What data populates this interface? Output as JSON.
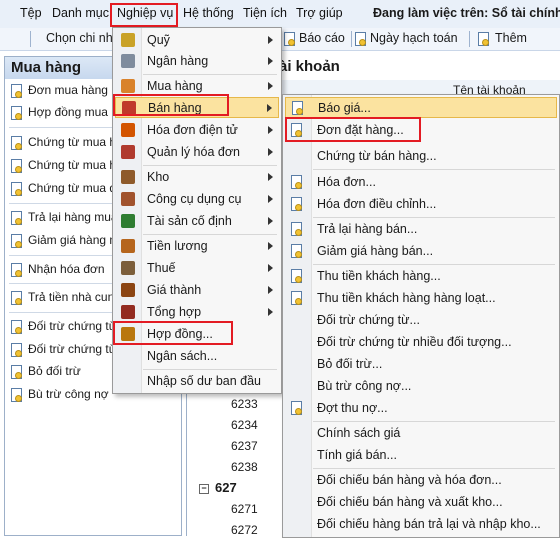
{
  "menubar": {
    "items": [
      "Tệp",
      "Danh mục",
      "Nghiệp vụ",
      "Hệ thống",
      "Tiện ích",
      "Trợ giúp"
    ],
    "status": "Đang làm việc trên: Sổ tài chính -"
  },
  "toolbar": {
    "items": [
      "Chọn chi nhá",
      "Báo cáo",
      "Ngày hạch toán",
      "Thêm"
    ]
  },
  "left_panel": {
    "title": "Mua hàng",
    "items": [
      "Đơn mua hàng",
      "Hợp đồng mua h",
      "Chứng từ mua hà",
      "Chứng từ mua h",
      "Chứng từ mua dị",
      "Trả lại hàng mua",
      "Giảm giá hàng m",
      "Nhận hóa đơn",
      "Trả tiền nhà cun",
      "Đối trừ chứng từ",
      "Đối trừ chứng từ",
      "Bỏ đối trừ",
      "Bù trừ công nợ"
    ]
  },
  "right_panel": {
    "title": "ài khoản",
    "col_name": "Tên tài khoản",
    "rows_before": [
      "6233",
      "6234",
      "6237",
      "6238"
    ],
    "group": "627",
    "rows_after": [
      "6271",
      "6272"
    ]
  },
  "main_menu": {
    "items": [
      {
        "label": "Quỹ",
        "sub": true,
        "color": "#c9a227"
      },
      {
        "label": "Ngân hàng",
        "sub": true,
        "color": "#7f8c9d"
      },
      {
        "label": "Mua hàng",
        "sub": true,
        "color": "#d9822b"
      },
      {
        "label": "Bán hàng",
        "sub": true,
        "color": "#c0392b"
      },
      {
        "label": "Hóa đơn điện tử",
        "sub": true,
        "color": "#d35400"
      },
      {
        "label": "Quản lý hóa đơn",
        "sub": true,
        "color": "#b03a2e"
      },
      {
        "label": "Kho",
        "sub": true,
        "color": "#8e5a2b"
      },
      {
        "label": "Công cụ dụng cụ",
        "sub": true,
        "color": "#a0522d"
      },
      {
        "label": "Tài sản cố định",
        "sub": true,
        "color": "#2e7d32"
      },
      {
        "label": "Tiền lương",
        "sub": true,
        "color": "#b5651d"
      },
      {
        "label": "Thuế",
        "sub": true,
        "color": "#7b5e3b"
      },
      {
        "label": "Giá thành",
        "sub": true,
        "color": "#8b4513"
      },
      {
        "label": "Tổng hợp",
        "sub": true,
        "color": "#922b21"
      },
      {
        "label": "Hợp đồng...",
        "sub": false,
        "color": "#b9770e"
      },
      {
        "label": "Ngân sách...",
        "sub": false,
        "color": ""
      },
      {
        "label": "Nhập số dư ban đầu",
        "sub": false,
        "color": ""
      }
    ]
  },
  "sub_menu": {
    "items": [
      "Báo giá...",
      "Đơn đặt hàng...",
      "Chứng từ bán hàng...",
      "Hóa đơn...",
      "Hóa đơn điều chỉnh...",
      "Trả lại hàng bán...",
      "Giảm giá hàng bán...",
      "Thu tiền khách hàng...",
      "Thu tiền khách hàng hàng loạt...",
      "Đối trừ chứng từ...",
      "Đối trừ chứng từ nhiều đối tượng...",
      "Bỏ đối trừ...",
      "Bù trừ công nợ...",
      "Đợt thu nợ...",
      "Chính sách giá",
      "Tính giá bán...",
      "Đối chiếu bán hàng và hóa đơn...",
      "Đối chiếu bán hàng và xuất kho...",
      "Đối chiếu hàng bán trả lại và nhập kho..."
    ]
  },
  "colors": {
    "highlight": "#e31b23",
    "active_item": "#fbe3a0"
  }
}
